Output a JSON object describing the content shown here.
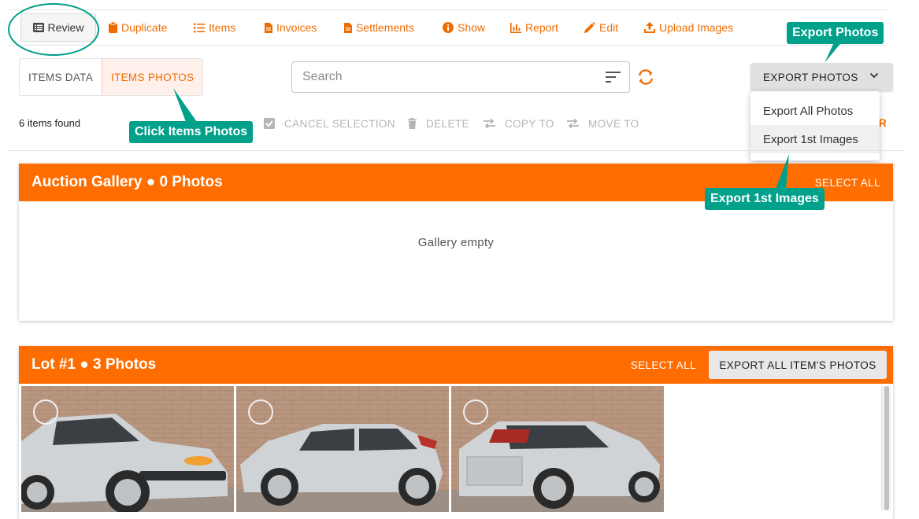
{
  "toolbar": {
    "review": "Review",
    "duplicate": "Duplicate",
    "items": "Items",
    "invoices": "Invoices",
    "settlements": "Settlements",
    "show": "Show",
    "report": "Report",
    "edit": "Edit",
    "upload_images": "Upload Images"
  },
  "tabs": {
    "items_data": "ITEMS DATA",
    "items_photos": "ITEMS PHOTOS"
  },
  "search": {
    "placeholder": "Search"
  },
  "export": {
    "button_label": "EXPORT PHOTOS",
    "menu": [
      "Export All Photos",
      "Export 1st Images"
    ]
  },
  "actions": {
    "count": "6 items found",
    "cancel_selection": "CANCEL SELECTION",
    "delete": "DELETE",
    "copy_to": "COPY TO",
    "move_to": "MOVE TO",
    "clear_fragment": "R"
  },
  "galleries": [
    {
      "title": "Auction Gallery ● 0 Photos",
      "select_all": "SELECT ALL",
      "empty_text": "Gallery empty"
    },
    {
      "title": "Lot #1 ● 3 Photos",
      "select_all": "SELECT ALL",
      "export_button": "EXPORT ALL ITEM'S PHOTOS"
    }
  ],
  "callouts": {
    "export_photos": "Export Photos",
    "click_items_photos": "Click Items Photos",
    "export_1st_images": "Export 1st Images"
  },
  "colors": {
    "accent": "#ff6d00",
    "link": "#ef6c00",
    "callout": "#00a08a"
  }
}
